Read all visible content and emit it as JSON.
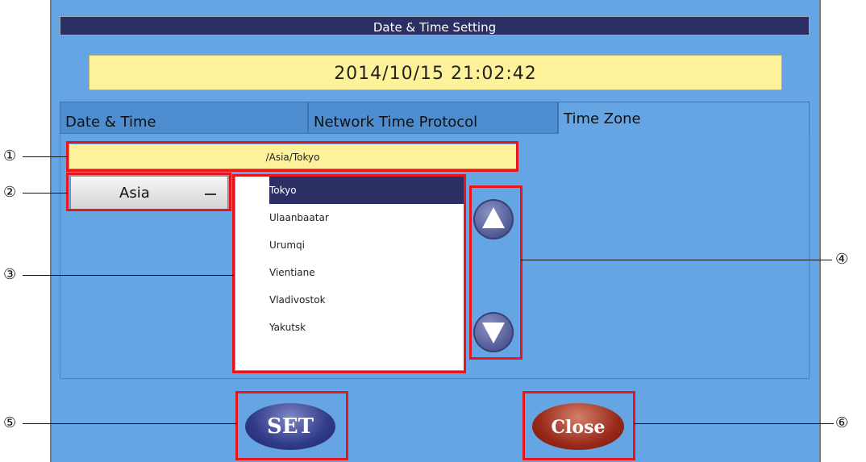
{
  "window": {
    "title": "Date & Time Setting"
  },
  "clock": {
    "datetime": "2014/10/15 21:02:42"
  },
  "tabs": [
    {
      "label": "Date & Time",
      "active": false
    },
    {
      "label": "Network Time Protocol",
      "active": false
    },
    {
      "label": "Time Zone",
      "active": true
    }
  ],
  "timezone": {
    "path": "/Asia/Tokyo",
    "region": "Asia",
    "cities": [
      "Tokyo",
      "Ulaanbaatar",
      "Urumqi",
      "Vientiane",
      "Vladivostok",
      "Yakutsk"
    ],
    "selected_city": "Tokyo"
  },
  "icons": {
    "scroll_up": "up-arrow-icon",
    "scroll_down": "down-arrow-icon",
    "dropdown": "dropdown-dash-icon"
  },
  "buttons": {
    "set": "SET",
    "close": "Close"
  },
  "callouts": [
    "①",
    "②",
    "③",
    "④",
    "⑤",
    "⑥"
  ],
  "colors": {
    "panel": "#65a5e4",
    "title_bar": "#2b2f63",
    "highlight": "#e5161c",
    "clock_bg": "#fdf29a"
  }
}
